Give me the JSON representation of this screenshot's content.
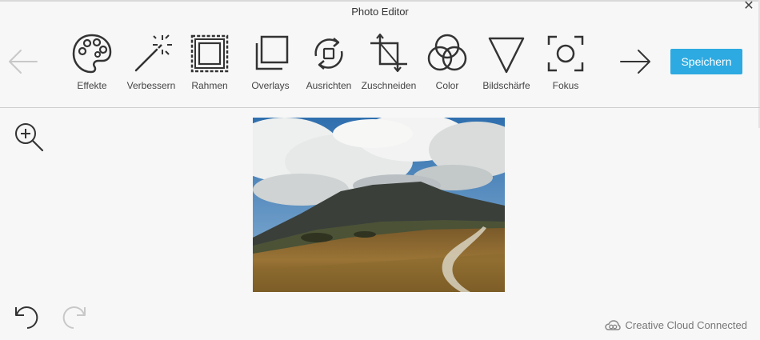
{
  "window": {
    "title": "Photo Editor",
    "close_glyph": "✕"
  },
  "toolbar": {
    "prev_icon": "arrow-left-icon",
    "next_icon": "arrow-right-icon",
    "tools": [
      {
        "id": "effekte",
        "label": "Effekte",
        "icon": "palette-icon"
      },
      {
        "id": "verbessern",
        "label": "Verbessern",
        "icon": "magic-wand-icon"
      },
      {
        "id": "rahmen",
        "label": "Rahmen",
        "icon": "frame-icon"
      },
      {
        "id": "overlays",
        "label": "Overlays",
        "icon": "overlays-icon"
      },
      {
        "id": "ausrichten",
        "label": "Ausrichten",
        "icon": "rotate-icon"
      },
      {
        "id": "zuschneiden",
        "label": "Zuschneiden",
        "icon": "crop-icon"
      },
      {
        "id": "color",
        "label": "Color",
        "icon": "color-circles-icon"
      },
      {
        "id": "bildschaerfe",
        "label": "Bildschärfe",
        "icon": "sharpness-triangle-icon"
      },
      {
        "id": "fokus",
        "label": "Fokus",
        "icon": "focus-icon"
      }
    ],
    "save_label": "Speichern"
  },
  "canvas": {
    "zoom_icon": "zoom-in-icon",
    "undo_icon": "undo-icon",
    "redo_icon": "redo-icon",
    "photo_subject": "landscape-photo"
  },
  "footer": {
    "cc_label": "Creative Cloud Connected",
    "cc_icon": "creative-cloud-icon"
  },
  "colors": {
    "accent": "#2daae1",
    "icon": "#333333",
    "disabled": "#c8c8c8"
  }
}
